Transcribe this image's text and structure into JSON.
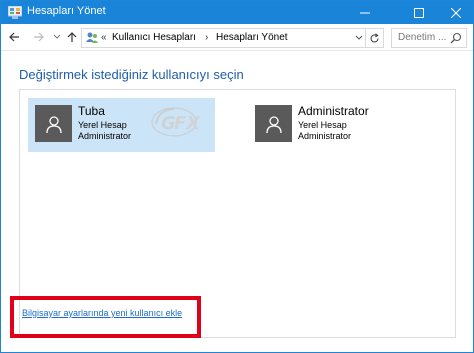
{
  "window": {
    "title": "Hesapları Yönet",
    "controls": {
      "minimize": "minimize",
      "maximize": "maximize",
      "close": "close"
    }
  },
  "nav": {
    "breadcrumb": [
      "Kullanıcı Hesapları",
      "Hesapları Yönet"
    ],
    "overflow_chevrons": "«",
    "separator": "›",
    "search_placeholder": "Denetim ..."
  },
  "content": {
    "heading": "Değiştirmek istediğiniz kullanıcıyı seçin",
    "users": [
      {
        "name": "Tuba",
        "account_type": "Yerel Hesap",
        "role": "Administrator",
        "selected": true
      },
      {
        "name": "Administrator",
        "account_type": "Yerel Hesap",
        "role": "Administrator",
        "selected": false
      }
    ],
    "add_user_link": "Bilgisayar ayarlarında yeni kullanıcı ekle"
  },
  "colors": {
    "titlebar": "#1a84d8",
    "heading": "#1e5fa8",
    "link": "#1e6ec8",
    "selected_tile": "#cce4f7",
    "avatar": "#5a5a5a",
    "highlight_box": "#e0001a"
  },
  "icons": [
    "control-panel-icon",
    "minimize-icon",
    "maximize-icon",
    "close-icon",
    "back-arrow-icon",
    "forward-arrow-icon",
    "chevron-down-icon",
    "up-arrow-icon",
    "users-icon",
    "refresh-icon",
    "search-icon",
    "user-avatar-icon"
  ]
}
